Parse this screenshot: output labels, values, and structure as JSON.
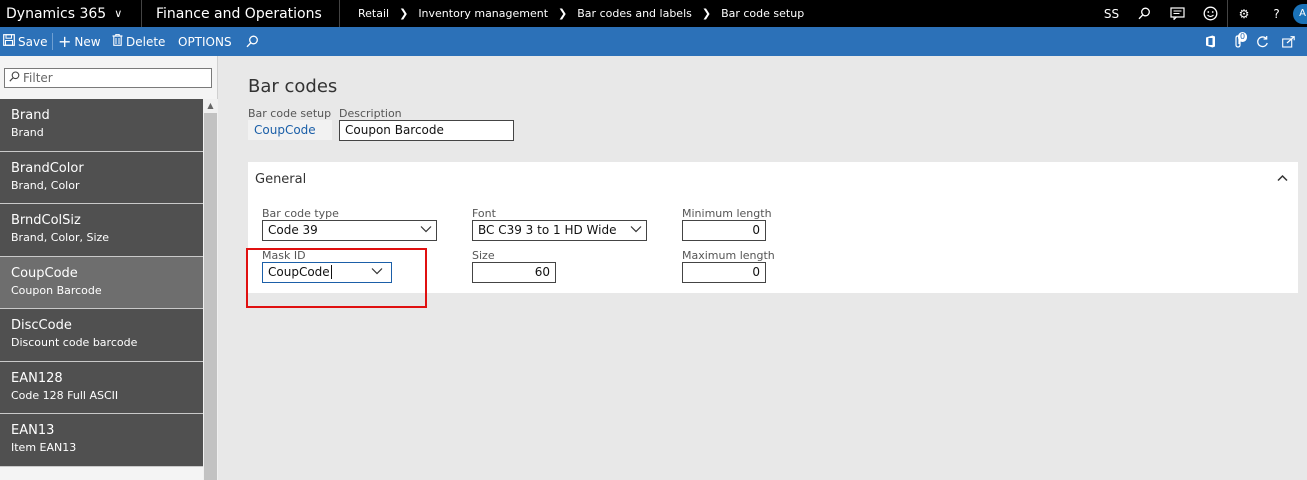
{
  "topbar": {
    "product": "Dynamics 365",
    "app": "Finance and Operations",
    "breadcrumbs": [
      "Retail",
      "Inventory management",
      "Bar codes and labels",
      "Bar code setup"
    ],
    "user_initials": "SS"
  },
  "actions": {
    "save": "Save",
    "new": "New",
    "delete": "Delete",
    "options": "OPTIONS",
    "notification_count": "0"
  },
  "filter": {
    "placeholder": "Filter"
  },
  "list": [
    {
      "title": "Brand",
      "subtitle": "Brand"
    },
    {
      "title": "BrandColor",
      "subtitle": "Brand, Color"
    },
    {
      "title": "BrndColSiz",
      "subtitle": "Brand, Color, Size"
    },
    {
      "title": "CoupCode",
      "subtitle": "Coupon Barcode",
      "selected": true
    },
    {
      "title": "DiscCode",
      "subtitle": "Discount code barcode"
    },
    {
      "title": "EAN128",
      "subtitle": "Code 128 Full ASCII"
    },
    {
      "title": "EAN13",
      "subtitle": "Item EAN13"
    }
  ],
  "form": {
    "title": "Bar codes",
    "barcode_setup_label": "Bar code setup",
    "barcode_setup_value": "CoupCode",
    "description_label": "Description",
    "description_value": "Coupon Barcode",
    "general": {
      "header": "General",
      "barcode_type_label": "Bar code type",
      "barcode_type_value": "Code 39",
      "font_label": "Font",
      "font_value": "BC C39 3 to 1 HD Wide",
      "min_length_label": "Minimum length",
      "min_length_value": "0",
      "mask_id_label": "Mask ID",
      "mask_id_value": "CoupCode",
      "size_label": "Size",
      "size_value": "60",
      "max_length_label": "Maximum length",
      "max_length_value": "0"
    }
  },
  "colors": {
    "topbar": "#000000",
    "actionbar": "#2c71b8",
    "list_item": "#505050",
    "list_item_selected": "#6e6e6e",
    "highlight_box": "#e01010"
  }
}
